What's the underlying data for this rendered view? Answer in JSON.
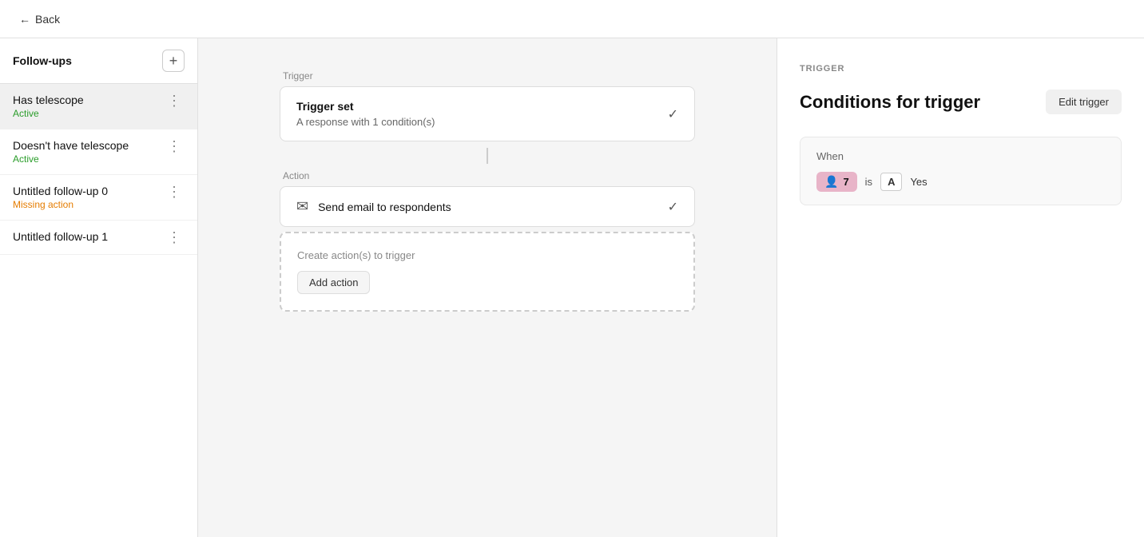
{
  "topbar": {
    "back_label": "Back"
  },
  "sidebar": {
    "title": "Follow-ups",
    "add_icon": "+",
    "items": [
      {
        "id": "has-telescope",
        "name": "Has telescope",
        "status": "Active",
        "status_type": "active",
        "is_selected": true
      },
      {
        "id": "doesnt-have-telescope",
        "name": "Doesn't have telescope",
        "status": "Active",
        "status_type": "active",
        "is_selected": false
      },
      {
        "id": "untitled-0",
        "name": "Untitled follow-up 0",
        "status": "Missing action",
        "status_type": "missing",
        "is_selected": false
      },
      {
        "id": "untitled-1",
        "name": "Untitled follow-up 1",
        "status": "",
        "status_type": "none",
        "is_selected": false
      }
    ]
  },
  "canvas": {
    "trigger_label": "Trigger",
    "trigger_card": {
      "title": "Trigger set",
      "subtitle": "A response with 1 condition(s)"
    },
    "action_label": "Action",
    "action_card": {
      "label": "Send email to respondents"
    },
    "create_actions": {
      "title": "Create action(s) to trigger",
      "add_button": "Add action"
    }
  },
  "right_panel": {
    "section_label": "TRIGGER",
    "title": "Conditions for trigger",
    "edit_button": "Edit trigger",
    "condition": {
      "when": "When",
      "chip_icon": "👤",
      "chip_num": "7",
      "is_text": "is",
      "a_label": "A",
      "value": "Yes"
    }
  }
}
